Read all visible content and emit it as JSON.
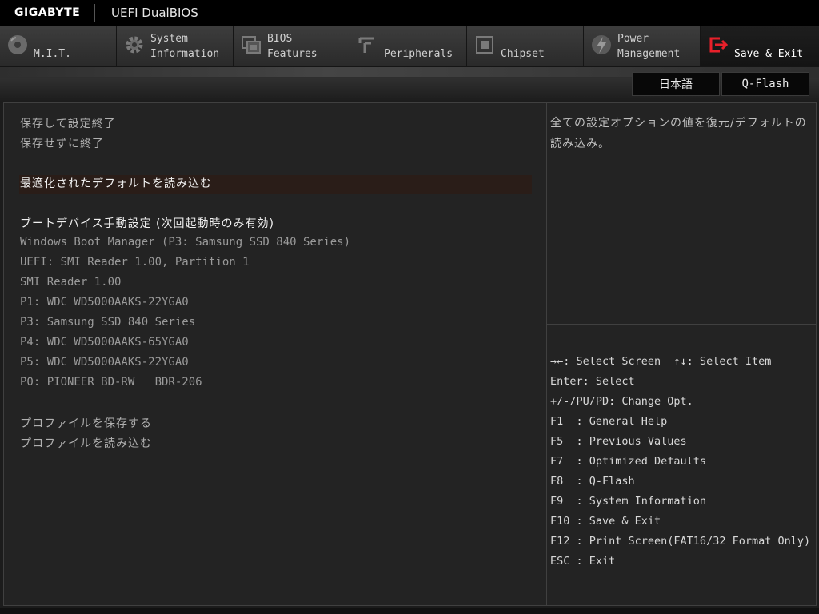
{
  "brand": "GIGABYTE",
  "product": "UEFI DualBIOS",
  "tabs": [
    {
      "label": "\nM.I.T.",
      "icon": "disc-icon"
    },
    {
      "label": "System\nInformation",
      "icon": "gear-icon"
    },
    {
      "label": "BIOS\nFeatures",
      "icon": "chip-board-icon"
    },
    {
      "label": "\nPeripherals",
      "icon": "usb-icon"
    },
    {
      "label": "\nChipset",
      "icon": "chip-icon"
    },
    {
      "label": "Power\nManagement",
      "icon": "lightning-icon"
    },
    {
      "label": "\nSave & Exit",
      "icon": "exit-door-icon"
    }
  ],
  "active_tab": "Save & Exit",
  "subbar": {
    "language": "日本語",
    "qflash": "Q-Flash"
  },
  "menu": {
    "save_exit": "保存して設定終了",
    "exit_no_save": "保存せずに終了",
    "load_optimized": "最適化されたデフォルトを読み込む",
    "boot_override_header": "ブートデバイス手動設定 (次回起動時のみ有効)",
    "boot_devices": [
      "Windows Boot Manager (P3: Samsung SSD 840 Series)",
      "UEFI: SMI Reader 1.00, Partition 1",
      "SMI Reader 1.00",
      "P1: WDC WD5000AAKS-22YGA0",
      "P3: Samsung SSD 840 Series",
      "P4: WDC WD5000AAKS-65YGA0",
      "P5: WDC WD5000AAKS-22YGA0",
      "P0: PIONEER BD-RW   BDR-206"
    ],
    "save_profile": "プロファイルを保存する",
    "load_profile": "プロファイルを読み込む"
  },
  "help_text": "全ての設定オプションの値を復元/デフォルトの読み込み。",
  "keys": [
    "→←: Select Screen  ↑↓: Select Item",
    "Enter: Select",
    "+/-/PU/PD: Change Opt.",
    "F1  : General Help",
    "F5  : Previous Values",
    "F7  : Optimized Defaults",
    "F8  : Q-Flash",
    "F9  : System Information",
    "F10 : Save & Exit",
    "F12 : Print Screen(FAT16/32 Format Only)",
    "ESC : Exit"
  ],
  "colors": {
    "accent": "#e8202a",
    "selection": "#2a1d18"
  }
}
